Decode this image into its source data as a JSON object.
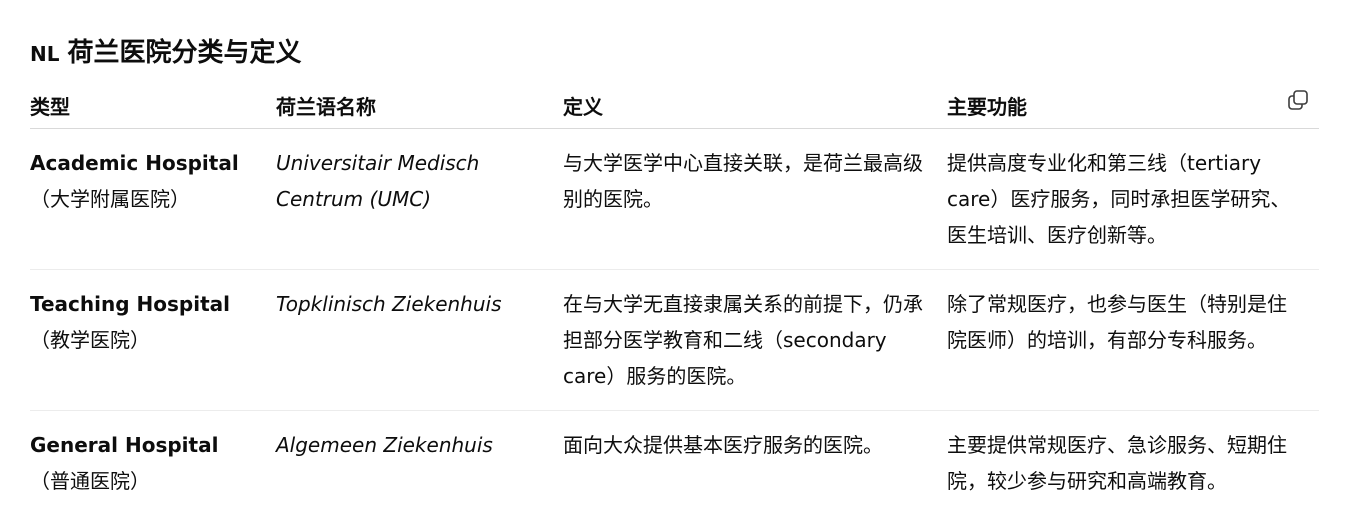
{
  "heading": {
    "flag": "NL",
    "title": "荷兰医院分类与定义"
  },
  "copy_icon": "copy-icon",
  "table": {
    "headers": [
      "类型",
      "荷兰语名称",
      "定义",
      "主要功能"
    ],
    "rows": [
      {
        "type_en": "Academic Hospital",
        "type_zh": "（大学附属医院）",
        "dutch_name": "Universitair Medisch Centrum (UMC)",
        "definition": "与大学医学中心直接关联，是荷兰最高级别的医院。",
        "function": "提供高度专业化和第三线（tertiary care）医疗服务，同时承担医学研究、医生培训、医疗创新等。"
      },
      {
        "type_en": "Teaching Hospital",
        "type_zh": "（教学医院）",
        "dutch_name": "Topklinisch Ziekenhuis",
        "definition": "在与大学无直接隶属关系的前提下，仍承担部分医学教育和二线（secondary care）服务的医院。",
        "function": "除了常规医疗，也参与医生（特别是住院医师）的培训，有部分专科服务。"
      },
      {
        "type_en": "General Hospital",
        "type_zh": "（普通医院）",
        "dutch_name": "Algemeen Ziekenhuis",
        "definition": "面向大众提供基本医疗服务的医院。",
        "function": "主要提供常规医疗、急诊服务、短期住院，较少参与研究和高端教育。"
      }
    ]
  }
}
